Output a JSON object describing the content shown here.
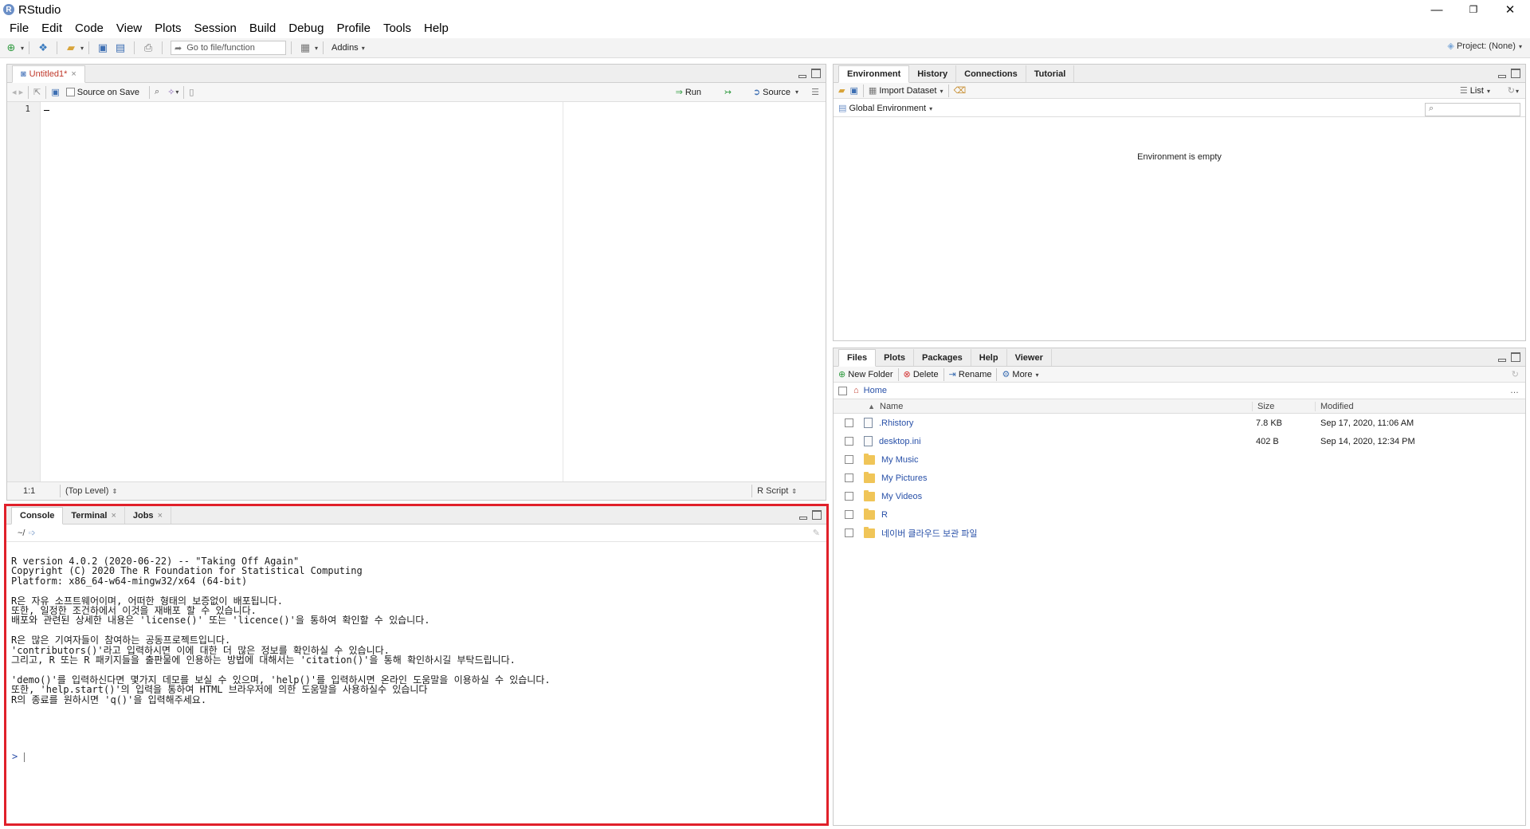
{
  "window": {
    "title": "RStudio",
    "controls": {
      "minimize": "—",
      "restore": "❐",
      "close": "✕"
    }
  },
  "menu": [
    "File",
    "Edit",
    "Code",
    "View",
    "Plots",
    "Session",
    "Build",
    "Debug",
    "Profile",
    "Tools",
    "Help"
  ],
  "toolbar": {
    "goto_placeholder": "Go to file/function",
    "addins_label": "Addins",
    "project_label": "Project: (None)"
  },
  "editor": {
    "tab_label": "Untitled1*",
    "source_on_save_label": "Source on Save",
    "run_label": "Run",
    "source_label": "Source",
    "line_number": "1",
    "cursor_position": "1:1",
    "scope": "(Top Level)",
    "file_type": "R Script"
  },
  "console": {
    "tabs": [
      "Console",
      "Terminal",
      "Jobs"
    ],
    "working_dir": "~/",
    "output": "R version 4.0.2 (2020-06-22) -- \"Taking Off Again\"\nCopyright (C) 2020 The R Foundation for Statistical Computing\nPlatform: x86_64-w64-mingw32/x64 (64-bit)\n\nR은 자유 소프트웨어이며, 어떠한 형태의 보증없이 배포됩니다.\n또한, 일정한 조건하에서 이것을 재배포 할 수 있습니다.\n배포와 관련된 상세한 내용은 'license()' 또는 'licence()'을 통하여 확인할 수 있습니다.\n\nR은 많은 기여자들이 참여하는 공동프로젝트입니다.\n'contributors()'라고 입력하시면 이에 대한 더 많은 정보를 확인하실 수 있습니다.\n그리고, R 또는 R 패키지들을 출판물에 인용하는 방법에 대해서는 'citation()'을 통해 확인하시길 부탁드립니다.\n\n'demo()'를 입력하신다면 몇가지 데모를 보실 수 있으며, 'help()'를 입력하시면 온라인 도움말을 이용하실 수 있습니다.\n또한, 'help.start()'의 입력을 통하여 HTML 브라우저에 의한 도움말을 사용하실수 있습니다\nR의 종료를 원하시면 'q()'을 입력해주세요.",
    "prompt": ">"
  },
  "environment": {
    "tabs": [
      "Environment",
      "History",
      "Connections",
      "Tutorial"
    ],
    "import_dataset_label": "Import Dataset",
    "list_label": "List",
    "scope_label": "Global Environment",
    "empty_message": "Environment is empty"
  },
  "files": {
    "tabs": [
      "Files",
      "Plots",
      "Packages",
      "Help",
      "Viewer"
    ],
    "actions": {
      "new_folder": "New Folder",
      "delete": "Delete",
      "rename": "Rename",
      "more": "More"
    },
    "breadcrumb": "Home",
    "columns": {
      "name": "Name",
      "size": "Size",
      "modified": "Modified"
    },
    "rows": [
      {
        "name": ".Rhistory",
        "size": "7.8 KB",
        "modified": "Sep 17, 2020, 11:06 AM",
        "type": "file"
      },
      {
        "name": "desktop.ini",
        "size": "402 B",
        "modified": "Sep 14, 2020, 12:34 PM",
        "type": "file"
      },
      {
        "name": "My Music",
        "size": "",
        "modified": "",
        "type": "folder"
      },
      {
        "name": "My Pictures",
        "size": "",
        "modified": "",
        "type": "folder"
      },
      {
        "name": "My Videos",
        "size": "",
        "modified": "",
        "type": "folder"
      },
      {
        "name": "R",
        "size": "",
        "modified": "",
        "type": "folder"
      },
      {
        "name": "네이버 클라우드 보관 파일",
        "size": "",
        "modified": "",
        "type": "folder"
      }
    ]
  },
  "colors": {
    "highlight_border": "#e0202a",
    "link": "#2850a8"
  }
}
